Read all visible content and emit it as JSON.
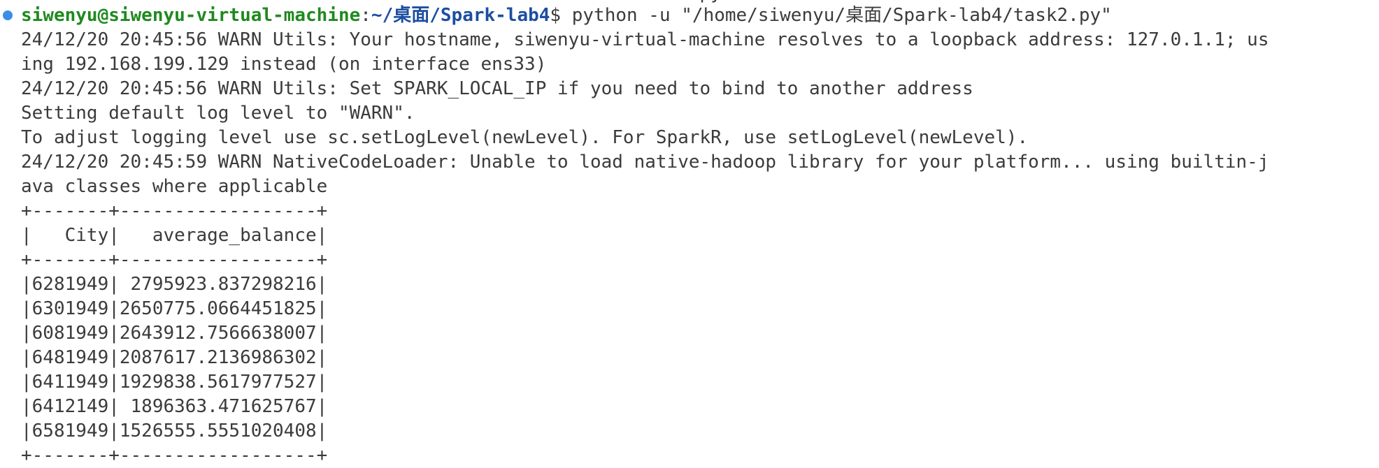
{
  "terminal": {
    "previous_line_fragment": "                                                              py",
    "prompt": {
      "user_host": "siwenyu@siwenyu-virtual-machine",
      "separator": ":",
      "path": "~/桌面/Spark-lab4",
      "symbol": "$",
      "command": " python -u \"/home/siwenyu/桌面/Spark-lab4/task2.py\""
    },
    "output_lines": [
      "24/12/20 20:45:56 WARN Utils: Your hostname, siwenyu-virtual-machine resolves to a loopback address: 127.0.1.1; us",
      "ing 192.168.199.129 instead (on interface ens33)",
      "24/12/20 20:45:56 WARN Utils: Set SPARK_LOCAL_IP if you need to bind to another address",
      "Setting default log level to \"WARN\".",
      "To adjust logging level use sc.setLogLevel(newLevel). For SparkR, use setLogLevel(newLevel).",
      "24/12/20 20:45:59 WARN NativeCodeLoader: Unable to load native-hadoop library for your platform... using builtin-j",
      "ava classes where applicable"
    ],
    "table": {
      "border": "+-------+------------------+",
      "header": "|   City|   average_balance|",
      "rows": [
        "|6281949| 2795923.837298216|",
        "|6301949|2650775.0664451825|",
        "|6081949|2643912.7566638007|",
        "|6481949|2087617.2136986302|",
        "|6411949|1929838.5617977527|",
        "|6412149| 1896363.471625767|",
        "|6581949|1526555.5551020408|"
      ]
    }
  }
}
